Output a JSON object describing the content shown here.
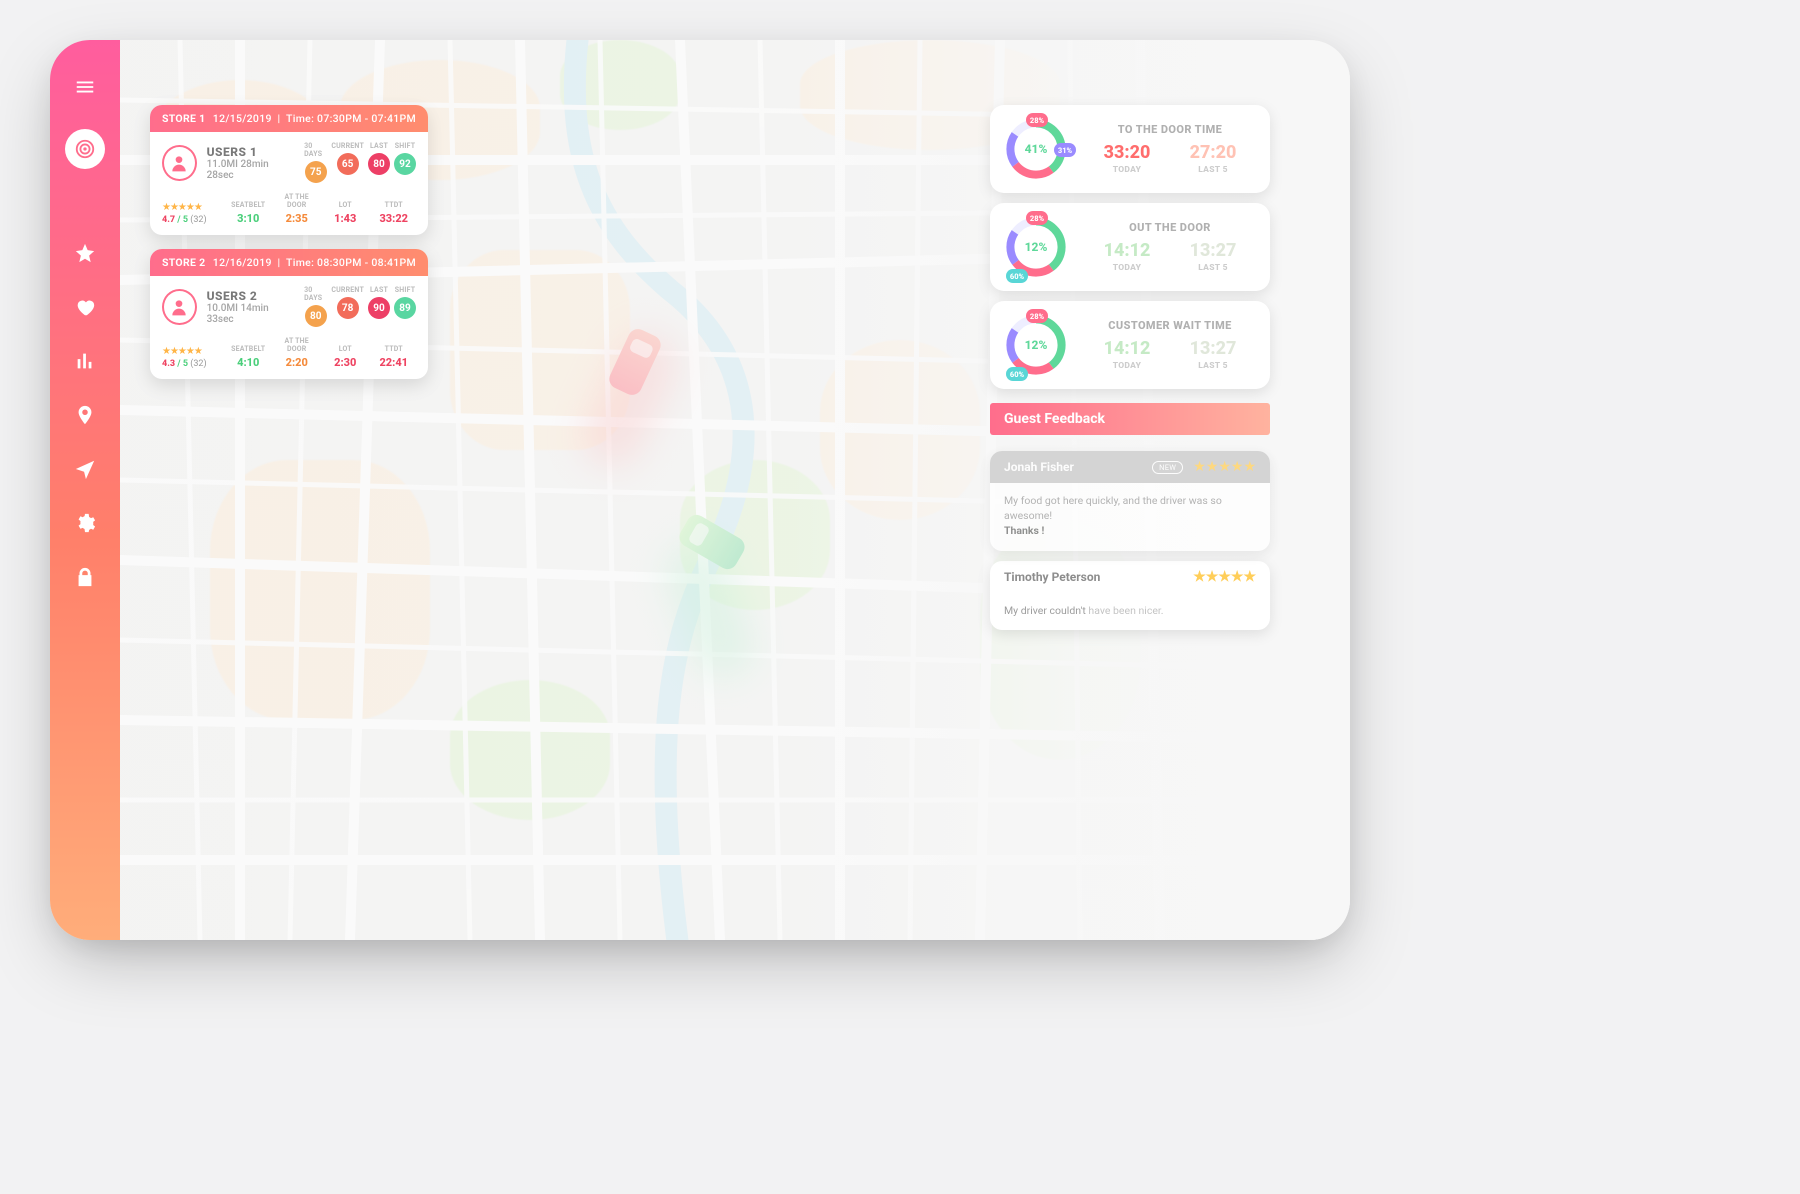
{
  "sidebar": {
    "items": [
      "menu",
      "target",
      "star",
      "heart",
      "chart",
      "pin",
      "nav",
      "gear",
      "lock"
    ],
    "active": 1
  },
  "stores": [
    {
      "title": "STORE 1",
      "date": "12/15/2019",
      "time": "Time: 07:30PM - 07:41PM",
      "user": "USERS 1",
      "sub": "11.0MI 28min 28sec",
      "chips": [
        {
          "lbl": "30 DAYS",
          "v": "75",
          "c": "c1"
        },
        {
          "lbl": "CURRENT",
          "v": "65",
          "c": "c2"
        },
        {
          "lbl": "LAST",
          "v": "80",
          "c": "c3"
        },
        {
          "lbl": "SHIFT",
          "v": "92",
          "c": "c4"
        }
      ],
      "rating": {
        "score": "4.7",
        "of": "/ 5",
        "count": "(32)"
      },
      "cols": [
        {
          "lbl": "SEATBELT",
          "v": "3:10",
          "c": "v-green"
        },
        {
          "lbl": "AT THE DOOR",
          "v": "2:35",
          "c": "v-orange"
        },
        {
          "lbl": "LOT",
          "v": "1:43",
          "c": "v-red"
        },
        {
          "lbl": "TTDT",
          "v": "33:22",
          "c": "v-red"
        }
      ]
    },
    {
      "title": "STORE 2",
      "date": "12/16/2019",
      "time": "Time: 08:30PM - 08:41PM",
      "user": "USERS 2",
      "sub": "10.0MI 14min 33sec",
      "chips": [
        {
          "lbl": "30 DAYS",
          "v": "80",
          "c": "c1"
        },
        {
          "lbl": "CURRENT",
          "v": "78",
          "c": "c2"
        },
        {
          "lbl": "LAST",
          "v": "90",
          "c": "c3"
        },
        {
          "lbl": "SHIFT",
          "v": "89",
          "c": "c4"
        }
      ],
      "rating": {
        "score": "4.3",
        "of": "/ 5",
        "count": "(32)"
      },
      "cols": [
        {
          "lbl": "SEATBELT",
          "v": "4:10",
          "c": "v-green"
        },
        {
          "lbl": "AT THE DOOR",
          "v": "2:20",
          "c": "v-orange"
        },
        {
          "lbl": "LOT",
          "v": "2:30",
          "c": "v-red"
        },
        {
          "lbl": "TTDT",
          "v": "22:41",
          "c": "v-red"
        }
      ]
    }
  ],
  "metrics": [
    {
      "title": "TO THE DOOR TIME",
      "pct": "41%",
      "b1": "28%",
      "b2": "31%",
      "a": "33:20",
      "al": "TODAY",
      "b": "27:20",
      "bl": "LAST 5",
      "cls": "m1"
    },
    {
      "title": "OUT THE DOOR",
      "pct": "12%",
      "b1": "28%",
      "b3": "60%",
      "a": "14:12",
      "al": "TODAY",
      "b": "13:27",
      "bl": "LAST 5",
      "cls": "m2"
    },
    {
      "title": "CUSTOMER WAIT TIME",
      "pct": "12%",
      "b1": "28%",
      "b3": "60%",
      "a": "14:12",
      "al": "TODAY",
      "b": "13:27",
      "bl": "LAST 5",
      "cls": "m3"
    }
  ],
  "feedback": {
    "title": "Guest Feedback",
    "items": [
      {
        "name": "Jonah Fisher",
        "new": "NEW",
        "msg": "My food got here quickly, and the driver was so awesome!",
        "msg2": "Thanks !",
        "dim": true,
        "stars": 5
      },
      {
        "name": "Timothy Peterson",
        "msg": "My driver couldn't ",
        "msg_light": "have been nicer.",
        "plain": true,
        "stars": 5
      }
    ]
  }
}
